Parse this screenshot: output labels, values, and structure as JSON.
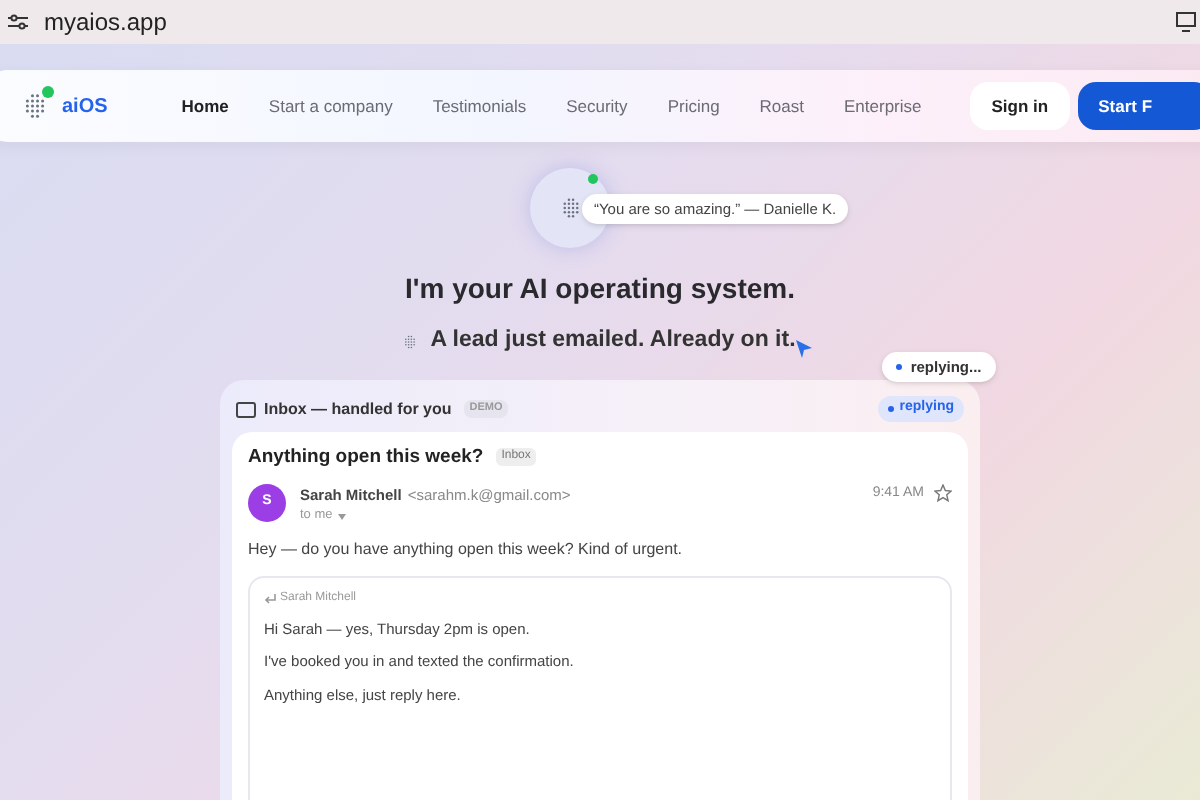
{
  "browser": {
    "url": "myaios.app"
  },
  "nav": {
    "brand": "aiOS",
    "online": true,
    "links": [
      {
        "label": "Home",
        "selected": true
      },
      {
        "label": "Start a company",
        "selected": false
      },
      {
        "label": "Testimonials",
        "selected": false
      },
      {
        "label": "Security",
        "selected": false
      },
      {
        "label": "Pricing",
        "selected": false
      },
      {
        "label": "Roast",
        "selected": false
      },
      {
        "label": "Enterprise",
        "selected": false
      }
    ],
    "sign_in": "Sign in",
    "cta": "Start F"
  },
  "hero": {
    "online": true,
    "quote": "“You are so amazing.” — Danielle K.",
    "title": "I'm your AI operating system.",
    "subtitle": "A lead just emailed. Already on it.",
    "status_bubble": "replying..."
  },
  "inbox": {
    "title": "Inbox — handled for you",
    "badge": "DEMO",
    "status": "replying",
    "email": {
      "subject": "Anything open this week?",
      "label": "Inbox",
      "avatar": "S",
      "sender": "Sarah Mitchell",
      "address": "<sarahm.k@gmail.com>",
      "to": "to me",
      "time": "9:41 AM",
      "starred": false,
      "body": "Hey — do you have anything open this week? Kind of urgent.",
      "reply": {
        "to": "Sarah Mitchell",
        "lines": [
          "Hi Sarah — yes, Thursday 2pm is open.",
          "I've booked you in and texted the confirmation.",
          "Anything else, just reply here."
        ]
      }
    }
  }
}
